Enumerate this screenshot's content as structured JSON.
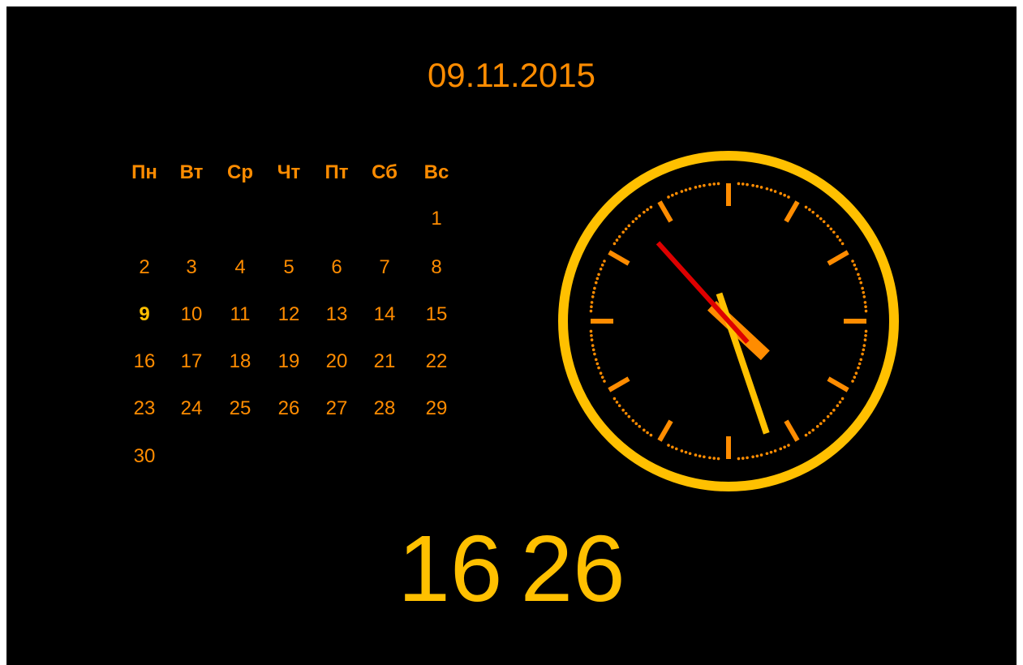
{
  "colors": {
    "background": "#000000",
    "primary_orange": "#ff8c00",
    "accent_yellow": "#ffc000",
    "second_hand_red": "#dd0000"
  },
  "date": {
    "text": "09.11.2015"
  },
  "calendar": {
    "weekdays": [
      "Пн",
      "Вт",
      "Ср",
      "Чт",
      "Пт",
      "Сб",
      "Вс"
    ],
    "weeks": [
      [
        "",
        "",
        "",
        "",
        "",
        "",
        "1"
      ],
      [
        "2",
        "3",
        "4",
        "5",
        "6",
        "7",
        "8"
      ],
      [
        "9",
        "10",
        "11",
        "12",
        "13",
        "14",
        "15"
      ],
      [
        "16",
        "17",
        "18",
        "19",
        "20",
        "21",
        "22"
      ],
      [
        "23",
        "24",
        "25",
        "26",
        "27",
        "28",
        "29"
      ],
      [
        "30",
        "",
        "",
        "",
        "",
        "",
        ""
      ]
    ],
    "today": "9"
  },
  "clock": {
    "hours": 16,
    "minutes": 26,
    "seconds": 53
  },
  "digital_time": {
    "text": "16 26"
  }
}
